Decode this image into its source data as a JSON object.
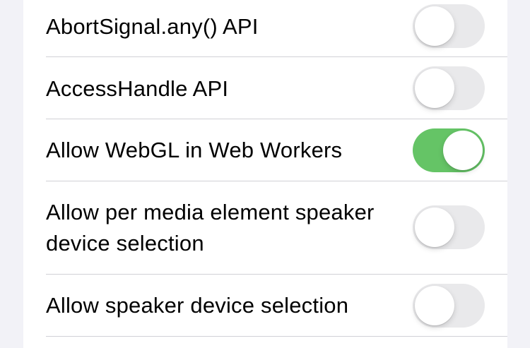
{
  "settings": [
    {
      "label": "AbortSignal.any() API",
      "enabled": false
    },
    {
      "label": "AccessHandle API",
      "enabled": false
    },
    {
      "label": "Allow WebGL in Web Workers",
      "enabled": true
    },
    {
      "label_line1": "Allow per media element speaker",
      "label_line2": "device selection",
      "enabled": false
    },
    {
      "label": "Allow speaker device selection",
      "enabled": false
    }
  ],
  "colors": {
    "toggle_on": "#65c466",
    "toggle_off": "#e9e9eb",
    "background": "#f2f2f7",
    "divider": "#d1d1d6"
  }
}
